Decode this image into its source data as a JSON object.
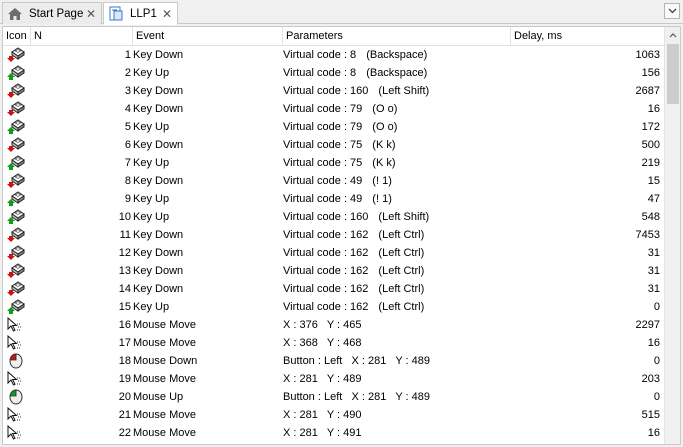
{
  "tabs": [
    {
      "label": "Start Page",
      "icon": "home-icon",
      "active": false
    },
    {
      "label": "LLP1",
      "icon": "document-icon",
      "active": true
    }
  ],
  "columns": {
    "icon": "Icon",
    "n": "N",
    "event": "Event",
    "parameters": "Parameters",
    "delay": "Delay, ms"
  },
  "rows": [
    {
      "icon": "key-down-icon",
      "n": "1",
      "event": "Key Down",
      "p1": "Virtual code : 8",
      "p2": "(Backspace)",
      "delay": "1063"
    },
    {
      "icon": "key-up-icon",
      "n": "2",
      "event": "Key Up",
      "p1": "Virtual code : 8",
      "p2": "(Backspace)",
      "delay": "156"
    },
    {
      "icon": "key-down-icon",
      "n": "3",
      "event": "Key Down",
      "p1": "Virtual code : 160",
      "p2": "(Left Shift)",
      "delay": "2687"
    },
    {
      "icon": "key-down-icon",
      "n": "4",
      "event": "Key Down",
      "p1": "Virtual code : 79",
      "p2": "(O o)",
      "delay": "16"
    },
    {
      "icon": "key-up-icon",
      "n": "5",
      "event": "Key Up",
      "p1": "Virtual code : 79",
      "p2": "(O o)",
      "delay": "172"
    },
    {
      "icon": "key-down-icon",
      "n": "6",
      "event": "Key Down",
      "p1": "Virtual code : 75",
      "p2": "(K k)",
      "delay": "500"
    },
    {
      "icon": "key-up-icon",
      "n": "7",
      "event": "Key Up",
      "p1": "Virtual code : 75",
      "p2": "(K k)",
      "delay": "219"
    },
    {
      "icon": "key-down-icon",
      "n": "8",
      "event": "Key Down",
      "p1": "Virtual code : 49",
      "p2": "(! 1)",
      "delay": "15"
    },
    {
      "icon": "key-up-icon",
      "n": "9",
      "event": "Key Up",
      "p1": "Virtual code : 49",
      "p2": "(! 1)",
      "delay": "47"
    },
    {
      "icon": "key-up-icon",
      "n": "10",
      "event": "Key Up",
      "p1": "Virtual code : 160",
      "p2": "(Left Shift)",
      "delay": "548"
    },
    {
      "icon": "key-down-icon",
      "n": "11",
      "event": "Key Down",
      "p1": "Virtual code : 162",
      "p2": "(Left Ctrl)",
      "delay": "7453"
    },
    {
      "icon": "key-down-icon",
      "n": "12",
      "event": "Key Down",
      "p1": "Virtual code : 162",
      "p2": "(Left Ctrl)",
      "delay": "31"
    },
    {
      "icon": "key-down-icon",
      "n": "13",
      "event": "Key Down",
      "p1": "Virtual code : 162",
      "p2": "(Left Ctrl)",
      "delay": "31"
    },
    {
      "icon": "key-down-icon",
      "n": "14",
      "event": "Key Down",
      "p1": "Virtual code : 162",
      "p2": "(Left Ctrl)",
      "delay": "31"
    },
    {
      "icon": "key-up-icon",
      "n": "15",
      "event": "Key Up",
      "p1": "Virtual code : 162",
      "p2": "(Left Ctrl)",
      "delay": "0"
    },
    {
      "icon": "mouse-move-icon",
      "n": "16",
      "event": "Mouse Move",
      "p1": "X : 376   Y : 465",
      "p2": "",
      "delay": "2297"
    },
    {
      "icon": "mouse-move-icon",
      "n": "17",
      "event": "Mouse Move",
      "p1": "X : 368   Y : 468",
      "p2": "",
      "delay": "16"
    },
    {
      "icon": "mouse-down-icon",
      "n": "18",
      "event": "Mouse Down",
      "p1": "Button : Left   X : 281   Y : 489",
      "p2": "",
      "delay": "0"
    },
    {
      "icon": "mouse-move-icon",
      "n": "19",
      "event": "Mouse Move",
      "p1": "X : 281   Y : 489",
      "p2": "",
      "delay": "203"
    },
    {
      "icon": "mouse-up-icon",
      "n": "20",
      "event": "Mouse Up",
      "p1": "Button : Left   X : 281   Y : 489",
      "p2": "",
      "delay": "0"
    },
    {
      "icon": "mouse-move-icon",
      "n": "21",
      "event": "Mouse Move",
      "p1": "X : 281   Y : 490",
      "p2": "",
      "delay": "515"
    },
    {
      "icon": "mouse-move-icon",
      "n": "22",
      "event": "Mouse Move",
      "p1": "X : 281   Y : 491",
      "p2": "",
      "delay": "16"
    }
  ],
  "colors": {
    "key_down_arrow": "#cc1111",
    "key_up_arrow": "#119922",
    "mouse_down": "#cc1111",
    "mouse_up": "#119922"
  }
}
